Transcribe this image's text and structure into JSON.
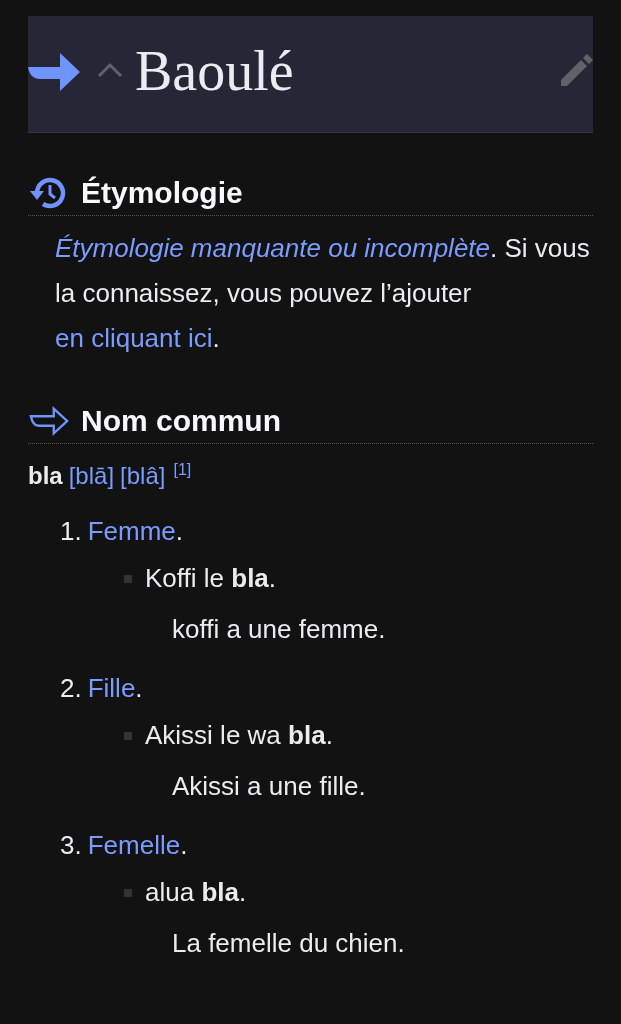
{
  "header": {
    "title": "Baoulé"
  },
  "sections": [
    {
      "kind": "etymology",
      "heading": "Étymologie",
      "paragraph": [
        {
          "text": "Étymologie manquante ou incomplète",
          "link": true,
          "italic": true
        },
        {
          "text": ". Si vous la connaissez, vous pouvez l’ajouter ",
          "link": false,
          "italic": false
        },
        {
          "text": "en cliquant ici",
          "link": true,
          "italic": false
        },
        {
          "text": ".",
          "link": false,
          "italic": false
        }
      ]
    },
    {
      "kind": "part_of_speech",
      "heading": "Nom commun",
      "headword": "bla",
      "pronunciations": [
        "[blā]",
        "[blâ]"
      ],
      "reference": "[1]",
      "senses": [
        {
          "number": "1.",
          "definition": "Femme",
          "definition_end": ".",
          "examples": [
            {
              "text": "Koffi le **bla**.",
              "translation": "koffi a une femme."
            }
          ]
        },
        {
          "number": "2.",
          "definition": "Fille",
          "definition_end": ".",
          "examples": [
            {
              "text": "Akissi le wa **bla**.",
              "translation": "Akissi a une fille."
            }
          ]
        },
        {
          "number": "3.",
          "definition": "Femelle",
          "definition_end": ".",
          "examples": [
            {
              "text": "alua **bla**.",
              "translation": "La femelle du chien."
            }
          ]
        }
      ]
    }
  ]
}
